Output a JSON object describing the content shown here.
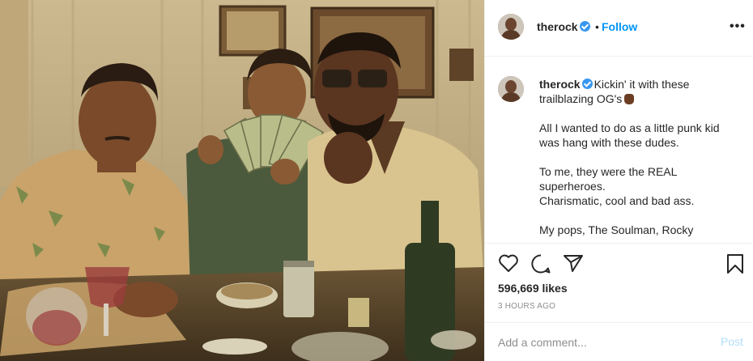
{
  "post": {
    "image_alt": "Four people sitting around a table, a boy holding up cash"
  },
  "header": {
    "username": "therock",
    "separator": "•",
    "follow_label": "Follow",
    "more_label": "•••"
  },
  "caption": {
    "username": "therock",
    "line1": "Kickin' it with these trailblazing OG's",
    "para2": "All I wanted to do as a little punk kid was hang with these dudes.",
    "para3a": "To me, they were the REAL superheroes.",
    "para3b": "Charismatic, cool and bad ass.",
    "para4": "My pops, The Soulman, Rocky"
  },
  "actions": {
    "likes": "596,669 likes",
    "time": "3 HOURS AGO"
  },
  "comment": {
    "placeholder": "Add a comment...",
    "post_label": "Post"
  },
  "colors": {
    "verified": "#3897f0",
    "follow": "#0095f6",
    "post_disabled": "#b2dffc",
    "muted": "#8e8e8e"
  }
}
